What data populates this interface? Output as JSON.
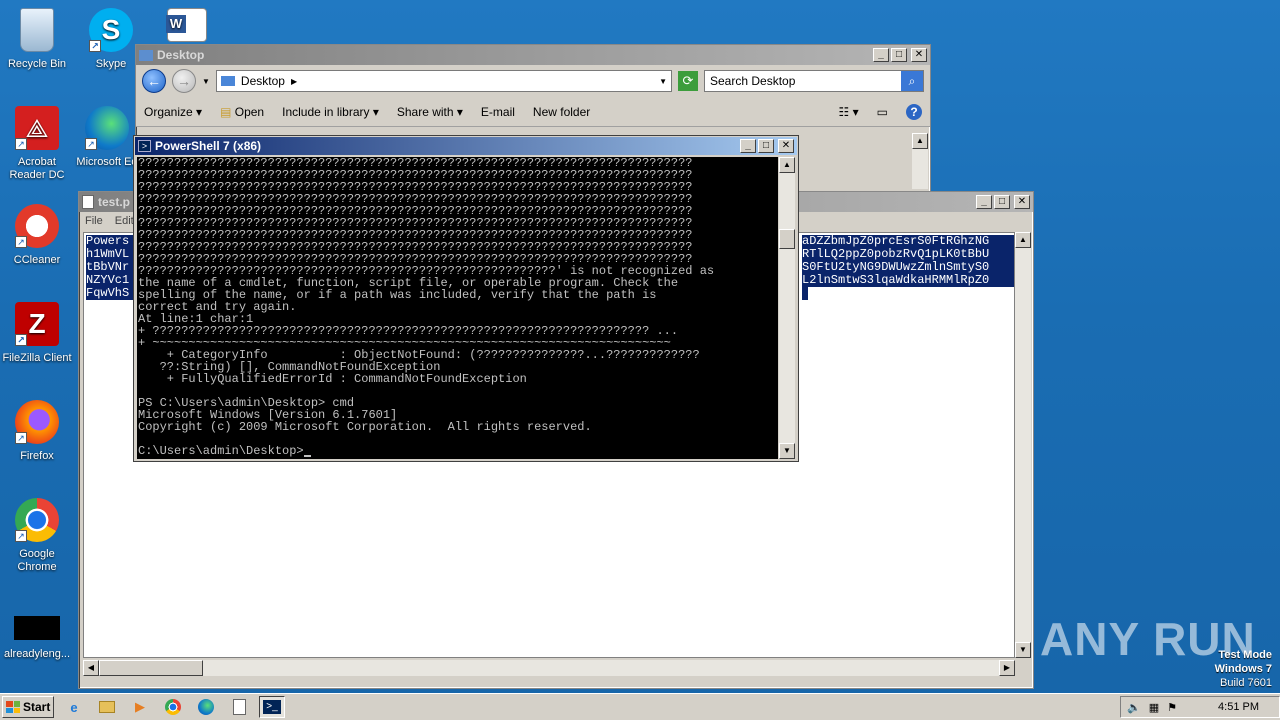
{
  "desktop": {
    "icons": [
      {
        "label": "Recycle Bin",
        "icon": "recycle-bin-icon"
      },
      {
        "label": "Skype",
        "icon": "skype-icon"
      },
      {
        "label": "Acrobat Reader DC",
        "icon": "acrobat-icon"
      },
      {
        "label": "Microsoft Edge",
        "icon": "edge-icon"
      },
      {
        "label": "CCleaner",
        "icon": "ccleaner-icon"
      },
      {
        "label": "FileZilla Client",
        "icon": "filezilla-icon"
      },
      {
        "label": "Firefox",
        "icon": "firefox-icon"
      },
      {
        "label": "Google Chrome",
        "icon": "chrome-icon"
      },
      {
        "label": "alreadyleng...",
        "icon": "black-file-icon"
      }
    ],
    "word_icon": "word-doc-icon",
    "edge_partial_label": "Microsoft Ed"
  },
  "explorer": {
    "title": "Desktop",
    "address": "Desktop",
    "search_placeholder": "Search Desktop",
    "commands": [
      "Organize",
      "Open",
      "Include in library",
      "Share with",
      "E-mail",
      "New folder"
    ]
  },
  "notepad": {
    "title": "test.p",
    "menu": [
      "File",
      "Edit"
    ],
    "lines_left": [
      "Powers",
      "h1WmVL",
      "tBbVNr",
      "NZYVc1",
      "FqwVhS"
    ],
    "lines_right": [
      "aDZZbmJpZ0prcEsrS0FtRGhzNG",
      "RTlLQ2ppZ0pobzRvQ1pLK0tBbU",
      "S0FtU2tyNG9DWUwzZmlnSmtyS0",
      "L2lnSmtwS3lqaWdkaHRMMlRpZ0",
      ""
    ]
  },
  "powershell": {
    "title": "PowerShell 7 (x86)",
    "lines": [
      "?????????????????????????????????????????????????????????????????????????????",
      "?????????????????????????????????????????????????????????????????????????????",
      "?????????????????????????????????????????????????????????????????????????????",
      "?????????????????????????????????????????????????????????????????????????????",
      "?????????????????????????????????????????????????????????????????????????????",
      "?????????????????????????????????????????????????????????????????????????????",
      "?????????????????????????????????????????????????????????????????????????????",
      "?????????????????????????????????????????????????????????????????????????????",
      "?????????????????????????????????????????????????????????????????????????????",
      "??????????????????????????????????????????????????????????' is not recognized as",
      "the name of a cmdlet, function, script file, or operable program. Check the",
      "spelling of the name, or if a path was included, verify that the path is",
      "correct and try again.",
      "At line:1 char:1",
      "+ ????????????????????????????????????????????????????????????????????? ...",
      "+ ~~~~~~~~~~~~~~~~~~~~~~~~~~~~~~~~~~~~~~~~~~~~~~~~~~~~~~~~~~~~~~~~~~~~~~~~",
      "    + CategoryInfo          : ObjectNotFound: (???????????????...?????????????",
      "   ??:String) [], CommandNotFoundException",
      "    + FullyQualifiedErrorId : CommandNotFoundException",
      "",
      "PS C:\\Users\\admin\\Desktop> cmd",
      "Microsoft Windows [Version 6.1.7601]",
      "Copyright (c) 2009 Microsoft Corporation.  All rights reserved.",
      "",
      "C:\\Users\\admin\\Desktop>"
    ]
  },
  "taskbar": {
    "start_label": "Start",
    "clock": "4:51 PM",
    "items": [
      "ie-icon",
      "explorer-icon",
      "media-player-icon",
      "chrome-icon",
      "edge-icon",
      "notepad-icon",
      "powershell-icon"
    ]
  },
  "watermark": {
    "line1": "Test Mode",
    "line2": "Windows 7",
    "line3": "Build 7601",
    "brand": "ANY RUN"
  }
}
